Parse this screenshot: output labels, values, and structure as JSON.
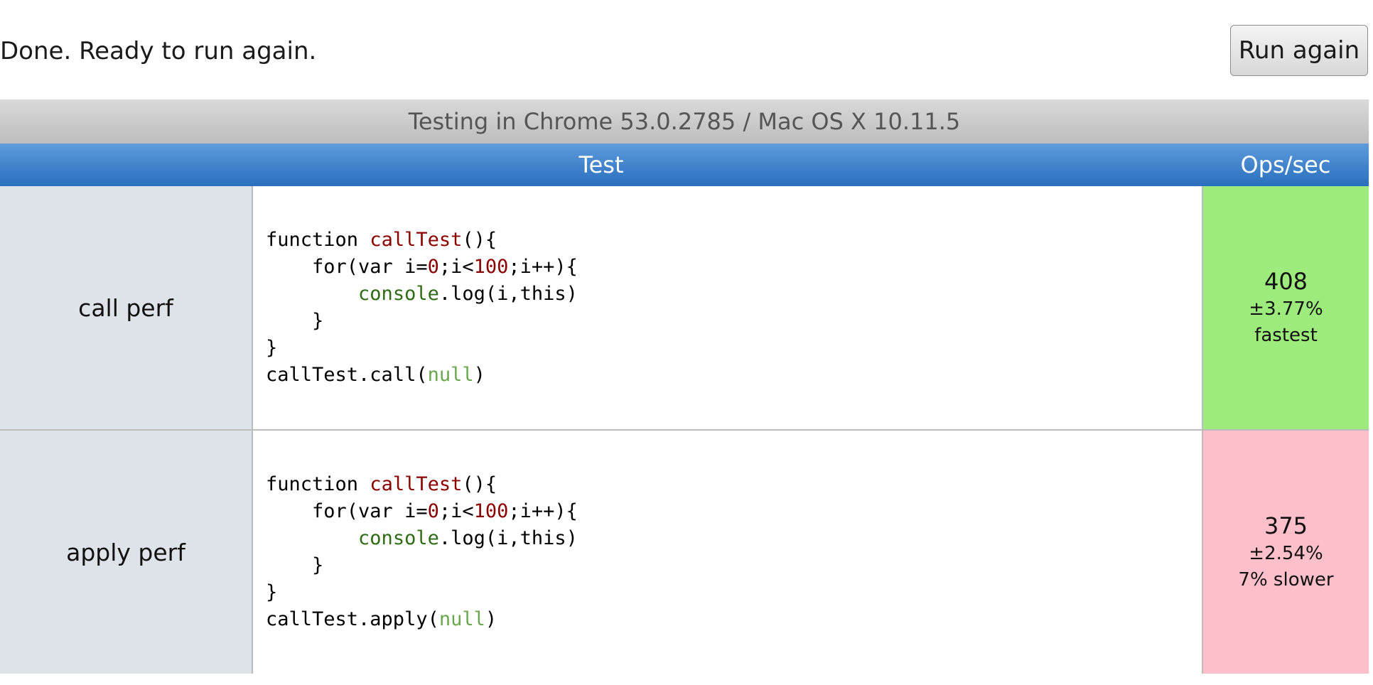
{
  "status": "Done. Ready to run again.",
  "run_button_label": "Run again",
  "environment": "Testing in Chrome 53.0.2785 / Mac OS X 10.11.5",
  "columns": {
    "test": "Test",
    "ops": "Ops/sec"
  },
  "tests": [
    {
      "name": "call perf",
      "code": {
        "line1_kw": "function ",
        "line1_fn": "callTest",
        "line1_end": "(){",
        "line2_a": "    for(var i=",
        "line2_n1": "0",
        "line2_b": ";i<",
        "line2_n2": "100",
        "line2_c": ";i++){",
        "line3_indent": "        ",
        "line3_obj": "console",
        "line3_rest": ".log(i,this)",
        "line4": "    }",
        "line5": "}",
        "line6_a": "callTest.call(",
        "line6_null": "null",
        "line6_b": ")"
      },
      "ops": "408",
      "rme": "±3.77%",
      "note": "fastest",
      "status_color": "#9deb7c"
    },
    {
      "name": "apply perf",
      "code": {
        "line1_kw": "function ",
        "line1_fn": "callTest",
        "line1_end": "(){",
        "line2_a": "    for(var i=",
        "line2_n1": "0",
        "line2_b": ";i<",
        "line2_n2": "100",
        "line2_c": ";i++){",
        "line3_indent": "        ",
        "line3_obj": "console",
        "line3_rest": ".log(i,this)",
        "line4": "    }",
        "line5": "}",
        "line6_a": "callTest.apply(",
        "line6_null": "null",
        "line6_b": ")"
      },
      "ops": "375",
      "rme": "±2.54%",
      "note": "7% slower",
      "status_color": "#fdc0cb"
    }
  ]
}
